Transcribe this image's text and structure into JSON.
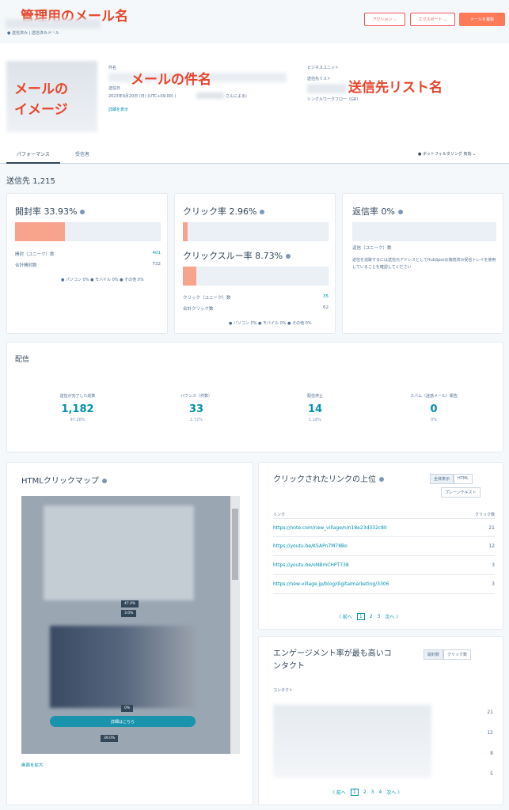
{
  "annotations": {
    "mail_name": "管理用のメール名",
    "mail_image": "メールの\nイメージ",
    "subject": "メールの件名",
    "list_name": "送信先リスト名"
  },
  "header": {
    "breadcrumb": "● 送信済み | 送信済みメール",
    "buttons": [
      "アクション ⌄",
      "エクスポート ⌄",
      "メールを複製"
    ]
  },
  "details": {
    "subject_label": "件名",
    "sent_label": "送信日",
    "sent_value": "2023年9月20日 (日) (UTC+09:00) (",
    "sent_by": "さんによる)",
    "details_link": "詳細を表示",
    "lists_label": "ビジネスユニット",
    "recipients_label": "送信先リスト",
    "workflow": "シングルワークフロー（GR）"
  },
  "tabs": [
    "パフォーマンス",
    "受信者"
  ],
  "bot_filter": "● ボットフィルタリング 有効 ⌄",
  "sent_count": "送信先 1,215",
  "open_card": {
    "title": "開封率",
    "pct": "33.93%",
    "fill": 0.34,
    "rows": [
      [
        "開封（ユニーク）数",
        "401"
      ],
      [
        "合計開封数",
        "732"
      ]
    ],
    "legend": "● パソコン 0%  ● モバイル 0%  ● その他 0%"
  },
  "click_card": {
    "title": "クリック率",
    "pct": "2.96%",
    "fill": 0.03,
    "title2": "クリックスルー率",
    "pct2": "8.73%",
    "fill2": 0.09,
    "rows": [
      [
        "クリック（ユニーク）数",
        "35"
      ],
      [
        "合計クリック数",
        "62"
      ]
    ],
    "legend": "● パソコン 0%  ● モバイル 0%  ● その他 0%"
  },
  "reply_card": {
    "title": "返信率",
    "pct": "0%",
    "fill": 0,
    "rows": [
      [
        "返信（ユニーク）数",
        "0"
      ]
    ],
    "note": "返信を追跡するには送信元アドレスとしてHubSpotの接続済み受信トレイを使用していることを確認してください"
  },
  "delivery": {
    "title": "配信",
    "stats": [
      {
        "label": "送信が完了した総数",
        "value": "1,182",
        "sub": "97.28%"
      },
      {
        "label": "バウンス（件数）",
        "value": "33",
        "sub": "2.72%"
      },
      {
        "label": "配信停止",
        "value": "14",
        "sub": "1.18%"
      },
      {
        "label": "スパム（迷惑メール）報告",
        "value": "0",
        "sub": "0%"
      }
    ]
  },
  "clickmap": {
    "title": "HTMLクリックマップ",
    "badges": [
      "47.0%",
      "3.0%",
      "0%",
      "39.0%"
    ],
    "button_text": "詳細はこちら",
    "expand_link": "画面を拡大"
  },
  "links_card": {
    "title": "クリックされたリンクの上位",
    "toggles": [
      "全体表示",
      "HTML"
    ],
    "plain": "プレーンテキスト",
    "col_link": "リンク",
    "col_clicks": "クリック数",
    "rows": [
      {
        "url": "https://note.com/new_village/n/n18e23d332c80",
        "clicks": "21"
      },
      {
        "url": "https://youtu.be/KSAPn7M78Bo",
        "clicks": "12"
      },
      {
        "url": "https://youtu.be/oNBmCHPT738",
        "clicks": "3"
      },
      {
        "url": "https://new-village.jp/blog/digitalmarketing/3306",
        "clicks": "3"
      }
    ],
    "pager": {
      "prev": "〈 前へ",
      "pages": [
        "1",
        "2",
        "3"
      ],
      "next": "次へ 〉"
    }
  },
  "engage_card": {
    "title": "エンゲージメント率が最も高いコンタクト",
    "toggles": [
      "開封数",
      "クリック数"
    ],
    "col": "コンタクト",
    "values": [
      "21",
      "12",
      "8",
      "5"
    ],
    "pager": {
      "prev": "〈 前へ",
      "pages": [
        "1",
        "2",
        "3",
        "4"
      ],
      "next": "次へ 〉"
    }
  }
}
